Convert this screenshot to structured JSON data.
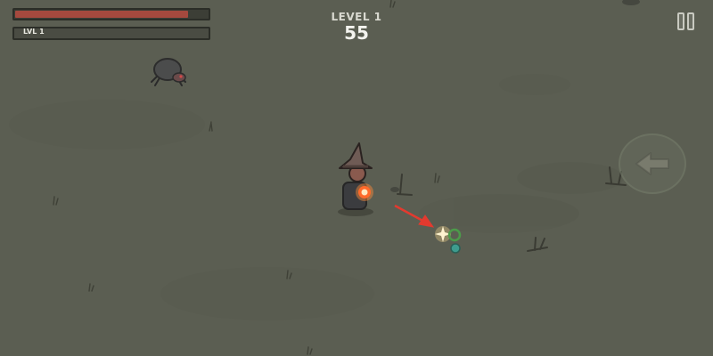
{
  "hud": {
    "health_fraction": 0.9,
    "xp_level_label": "LVL 1",
    "xp_fraction": 0.0
  },
  "level": {
    "title": "LEVEL 1",
    "timer": "55"
  },
  "controls": {
    "pause_icon": "pause-icon",
    "back_icon": "back-arrow-icon"
  },
  "colors": {
    "ground": "#5b5e52",
    "health": "#a5493e",
    "fireball": "#ff6a2a",
    "arrow": "#e33a2f"
  }
}
